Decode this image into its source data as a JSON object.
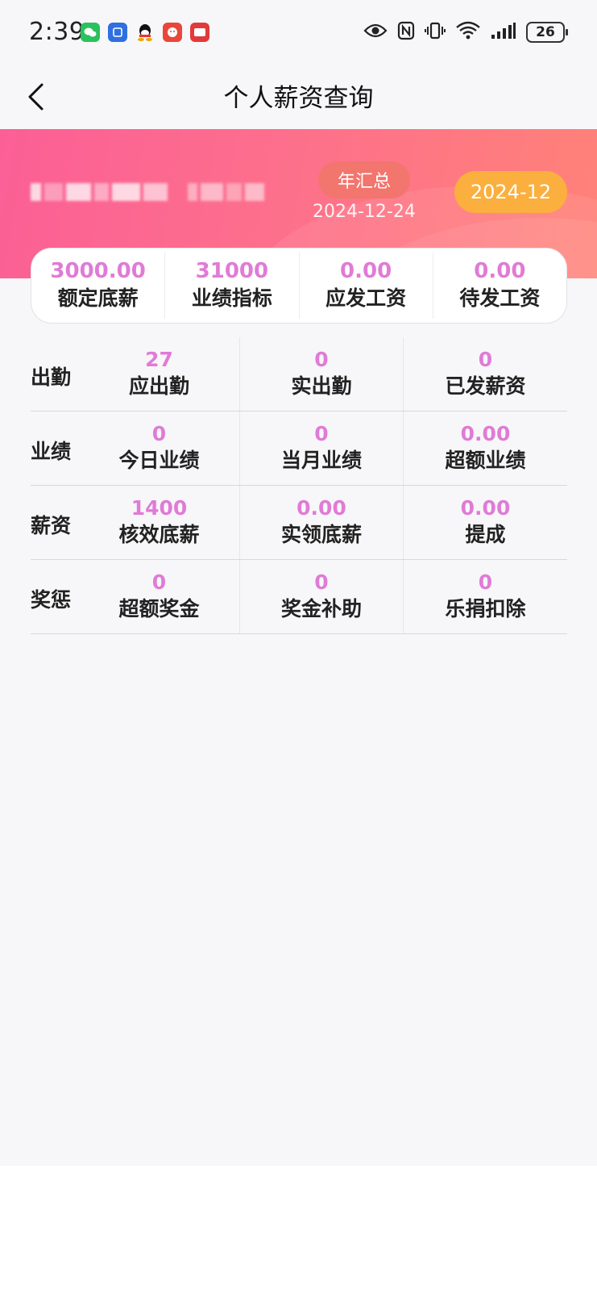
{
  "status_bar": {
    "time": "2:39",
    "battery": "26",
    "app_icons": [
      "wechat-icon",
      "app-blue-icon",
      "qq-icon",
      "tiger-app-icon",
      "mail-app-icon"
    ],
    "system_icons": [
      "eye-icon",
      "nfc-icon",
      "vibrate-icon",
      "wifi-icon",
      "signal-icon"
    ]
  },
  "nav": {
    "title": "个人薪资查询"
  },
  "header": {
    "year_summary_label": "年汇总",
    "date": "2024-12-24",
    "month": "2024-12"
  },
  "summary": [
    {
      "value": "3000.00",
      "label": "额定底薪"
    },
    {
      "value": "31000",
      "label": "业绩指标"
    },
    {
      "value": "0.00",
      "label": "应发工资"
    },
    {
      "value": "0.00",
      "label": "待发工资"
    }
  ],
  "grid": [
    {
      "heading": "出勤",
      "cells": [
        {
          "value": "27",
          "label": "应出勤"
        },
        {
          "value": "0",
          "label": "实出勤"
        },
        {
          "value": "0",
          "label": "已发薪资"
        }
      ]
    },
    {
      "heading": "业绩",
      "cells": [
        {
          "value": "0",
          "label": "今日业绩"
        },
        {
          "value": "0",
          "label": "当月业绩"
        },
        {
          "value": "0.00",
          "label": "超额业绩"
        }
      ]
    },
    {
      "heading": "薪资",
      "cells": [
        {
          "value": "1400",
          "label": "核效底薪"
        },
        {
          "value": "0.00",
          "label": "实领底薪"
        },
        {
          "value": "0.00",
          "label": "提成"
        }
      ]
    },
    {
      "heading": "奖惩",
      "cells": [
        {
          "value": "0",
          "label": "超额奖金"
        },
        {
          "value": "0",
          "label": "奖金补助"
        },
        {
          "value": "0",
          "label": "乐捐扣除"
        }
      ]
    }
  ],
  "colors": {
    "accent_value": "#e07bd6",
    "gradient_start": "#fb5f96",
    "gradient_end": "#ff8278",
    "month_badge": "#fbaf3e",
    "year_badge": "#f2756e"
  }
}
